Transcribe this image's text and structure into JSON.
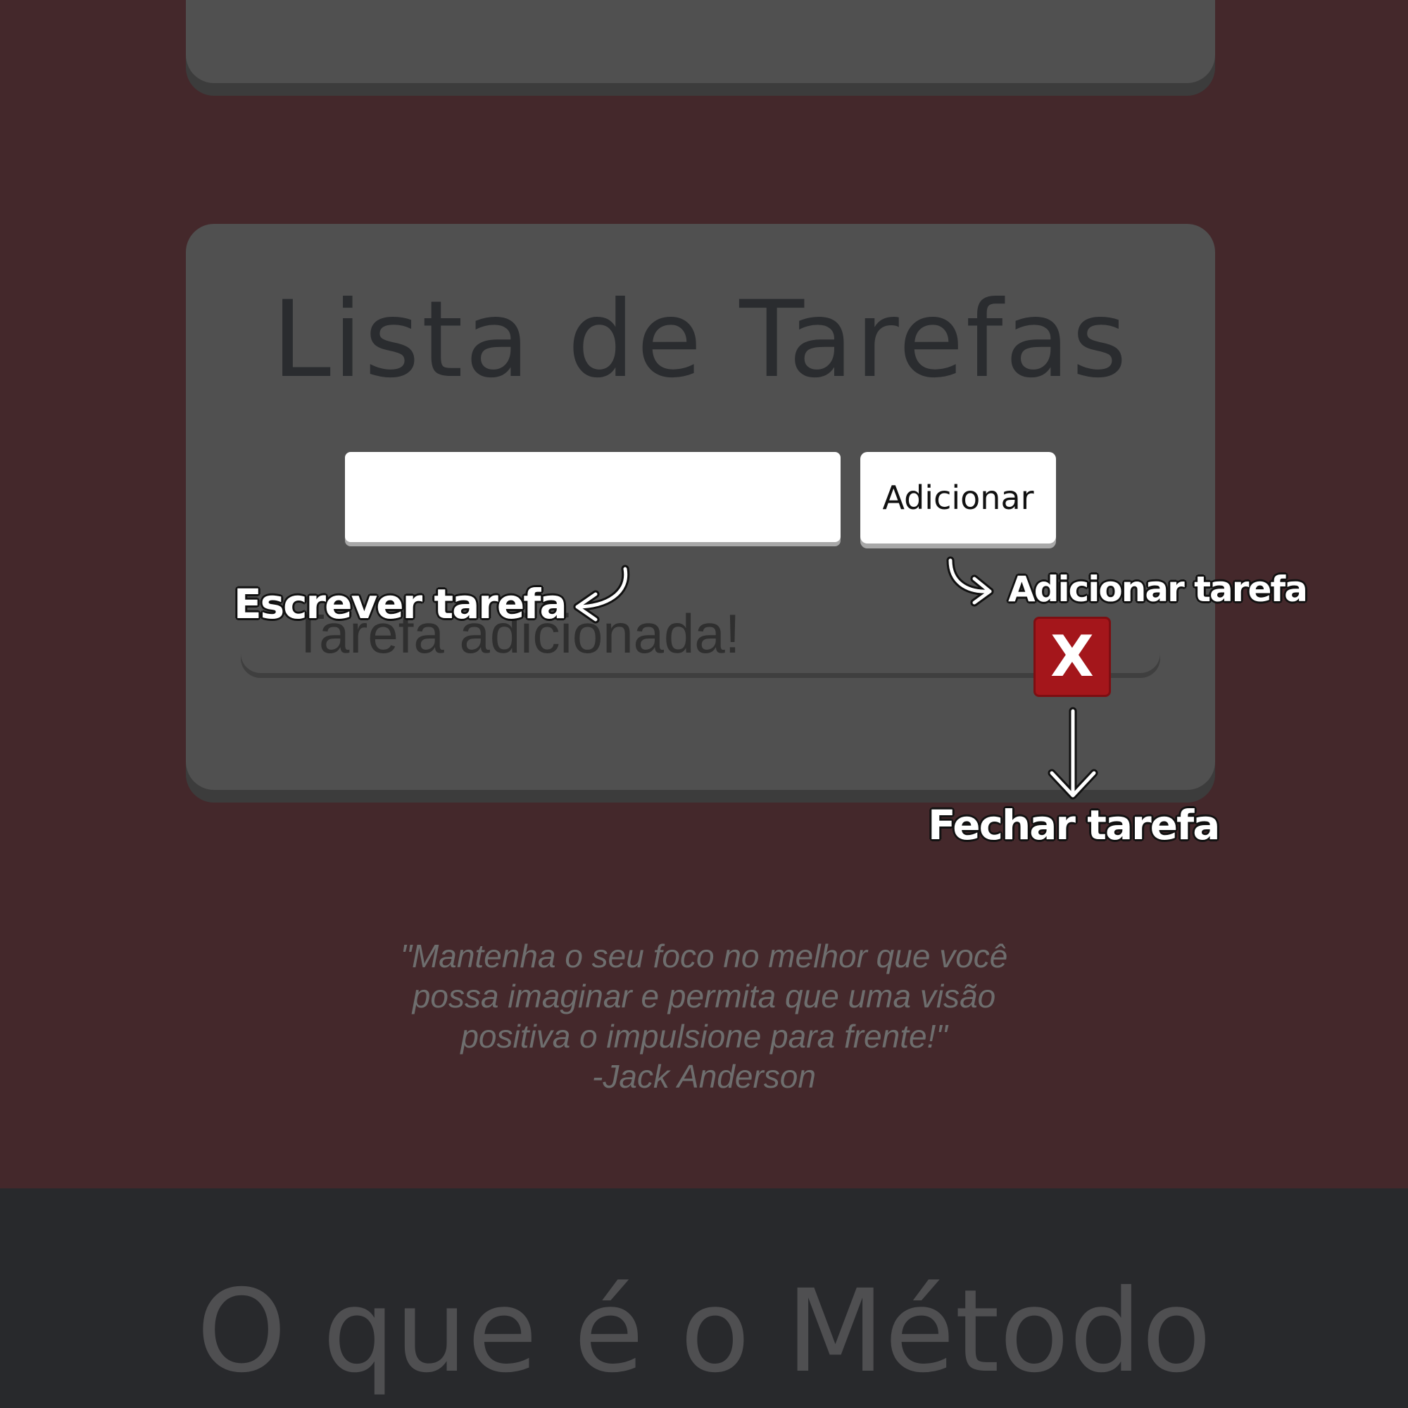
{
  "colors": {
    "background": "#44282B",
    "card": "#505050",
    "footer": "#28292C",
    "close_button": "#A4161B"
  },
  "timer_controls": {
    "icons": [
      "play-icon",
      "pause-icon",
      "reset-icon"
    ]
  },
  "todo": {
    "title": "Lista de Tarefas",
    "input_value": "",
    "add_button_label": "Adicionar",
    "tasks": [
      {
        "text": "Tarefa adicionada!",
        "close_label": "X"
      }
    ]
  },
  "annotations": {
    "write_task": "Escrever tarefa",
    "add_task": "Adicionar tarefa",
    "close_task": "Fechar tarefa"
  },
  "quote": {
    "lines": [
      "\"Mantenha o seu foco no melhor que você",
      "possa imaginar e permita que uma visão",
      "positiva o impulsione para frente!\""
    ],
    "author": "-Jack Anderson"
  },
  "footer": {
    "heading": "O que é o Método"
  }
}
